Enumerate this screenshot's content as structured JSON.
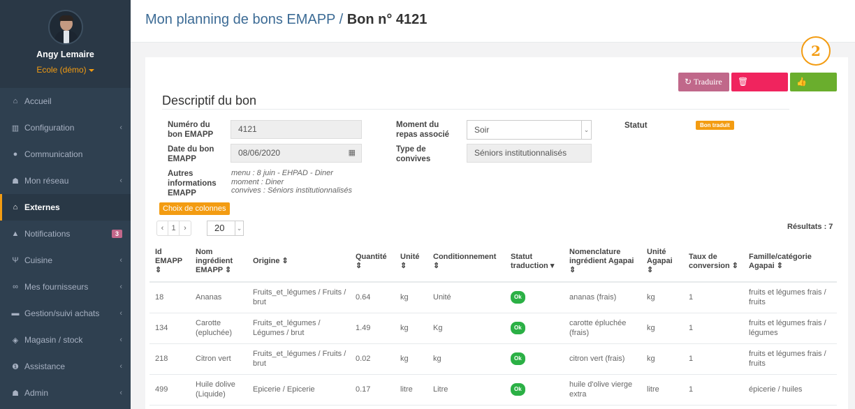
{
  "user": {
    "name": "Angy Lemaire",
    "role": "Ecole (démo)"
  },
  "nav": [
    {
      "label": "Accueil",
      "icon": "home-icon",
      "glyph": "⌂"
    },
    {
      "label": "Configuration",
      "icon": "institution-icon",
      "glyph": "▥"
    },
    {
      "label": "Communication",
      "icon": "chat-icon",
      "glyph": "●"
    },
    {
      "label": "Mon réseau",
      "icon": "users-icon",
      "glyph": "☗"
    },
    {
      "label": "Externes",
      "icon": "home-icon",
      "glyph": "⌂"
    },
    {
      "label": "Notifications",
      "icon": "bell-icon",
      "glyph": "▲",
      "badge": "3"
    },
    {
      "label": "Cuisine",
      "icon": "cutlery-icon",
      "glyph": "Ψ"
    },
    {
      "label": "Mes fournisseurs",
      "icon": "handshake-icon",
      "glyph": "∞"
    },
    {
      "label": "Gestion/suivi achats",
      "icon": "cart-icon",
      "glyph": "▬"
    },
    {
      "label": "Magasin / stock",
      "icon": "cubes-icon",
      "glyph": "◈"
    },
    {
      "label": "Assistance",
      "icon": "info-icon",
      "glyph": "❶"
    },
    {
      "label": "Admin",
      "icon": "user-plus-icon",
      "glyph": "☗"
    }
  ],
  "header": {
    "title_prefix": "Mon planning de bons EMAPP / ",
    "title_bold": "Bon n° 4121"
  },
  "step_number": "2",
  "actions": {
    "translate": "Traduire",
    "delete": "Supprimer",
    "validate": "Valider"
  },
  "section_title": "Descriptif du bon",
  "form": {
    "numero_label": "Numéro du bon EMAPP",
    "numero_value": "4121",
    "date_label": "Date du bon EMAPP",
    "date_value": "08/06/2020",
    "autres_label": "Autres informations EMAPP",
    "autres_lines": [
      "menu : 8 juin - EHPAD - Diner",
      "moment : Diner",
      "convives : Séniors institutionnalisés"
    ],
    "moment_label": "Moment du repas associé",
    "moment_value": "Soir",
    "type_label": "Type de convives",
    "type_value": "Séniors institutionnalisés",
    "statut_label": "Statut",
    "statut_value": "Bon traduit"
  },
  "columns_button": "Choix de colonnes",
  "pager": {
    "prev": "‹",
    "page": "1",
    "next": "›",
    "page_size": "20"
  },
  "results_label": "Résultats : 7",
  "table": {
    "headers": [
      "Id EMAPP ⇕",
      "Nom ingrédient EMAPP ⇕",
      "Origine ⇕",
      "Quantité ⇕",
      "Unité ⇕",
      "Conditionnement ⇕",
      "Statut traduction ▾",
      "Nomenclature ingrédient Agapai ⇕",
      "Unité Agapai ⇕",
      "Taux de conversion ⇕",
      "Famille/catégorie Agapai ⇕"
    ],
    "rows": [
      [
        "18",
        "Ananas",
        "Fruits_et_légumes / Fruits / brut",
        "0.64",
        "kg",
        "Unité",
        "Ok",
        "ananas (frais)",
        "kg",
        "1",
        "fruits et légumes frais / fruits"
      ],
      [
        "134",
        "Carotte (epluchée)",
        "Fruits_et_légumes / Légumes / brut",
        "1.49",
        "kg",
        "Kg",
        "Ok",
        "carotte épluchée (frais)",
        "kg",
        "1",
        "fruits et légumes frais / légumes"
      ],
      [
        "218",
        "Citron vert",
        "Fruits_et_légumes / Fruits / brut",
        "0.02",
        "kg",
        "kg",
        "Ok",
        "citron vert (frais)",
        "kg",
        "1",
        "fruits et légumes frais / fruits"
      ],
      [
        "499",
        "Huile dolive (Liquide)",
        "Epicerie / Epicerie",
        "0.17",
        "litre",
        "Litre",
        "Ok",
        "huile d'olive vierge extra",
        "litre",
        "1",
        "épicerie / huiles"
      ]
    ]
  },
  "colors": {
    "sidebar": "#2f4050",
    "accent": "#f39c12",
    "ok": "#2bb045",
    "validate": "#6aae2d",
    "delete": "#f0245e",
    "translate": "#c0688a"
  }
}
